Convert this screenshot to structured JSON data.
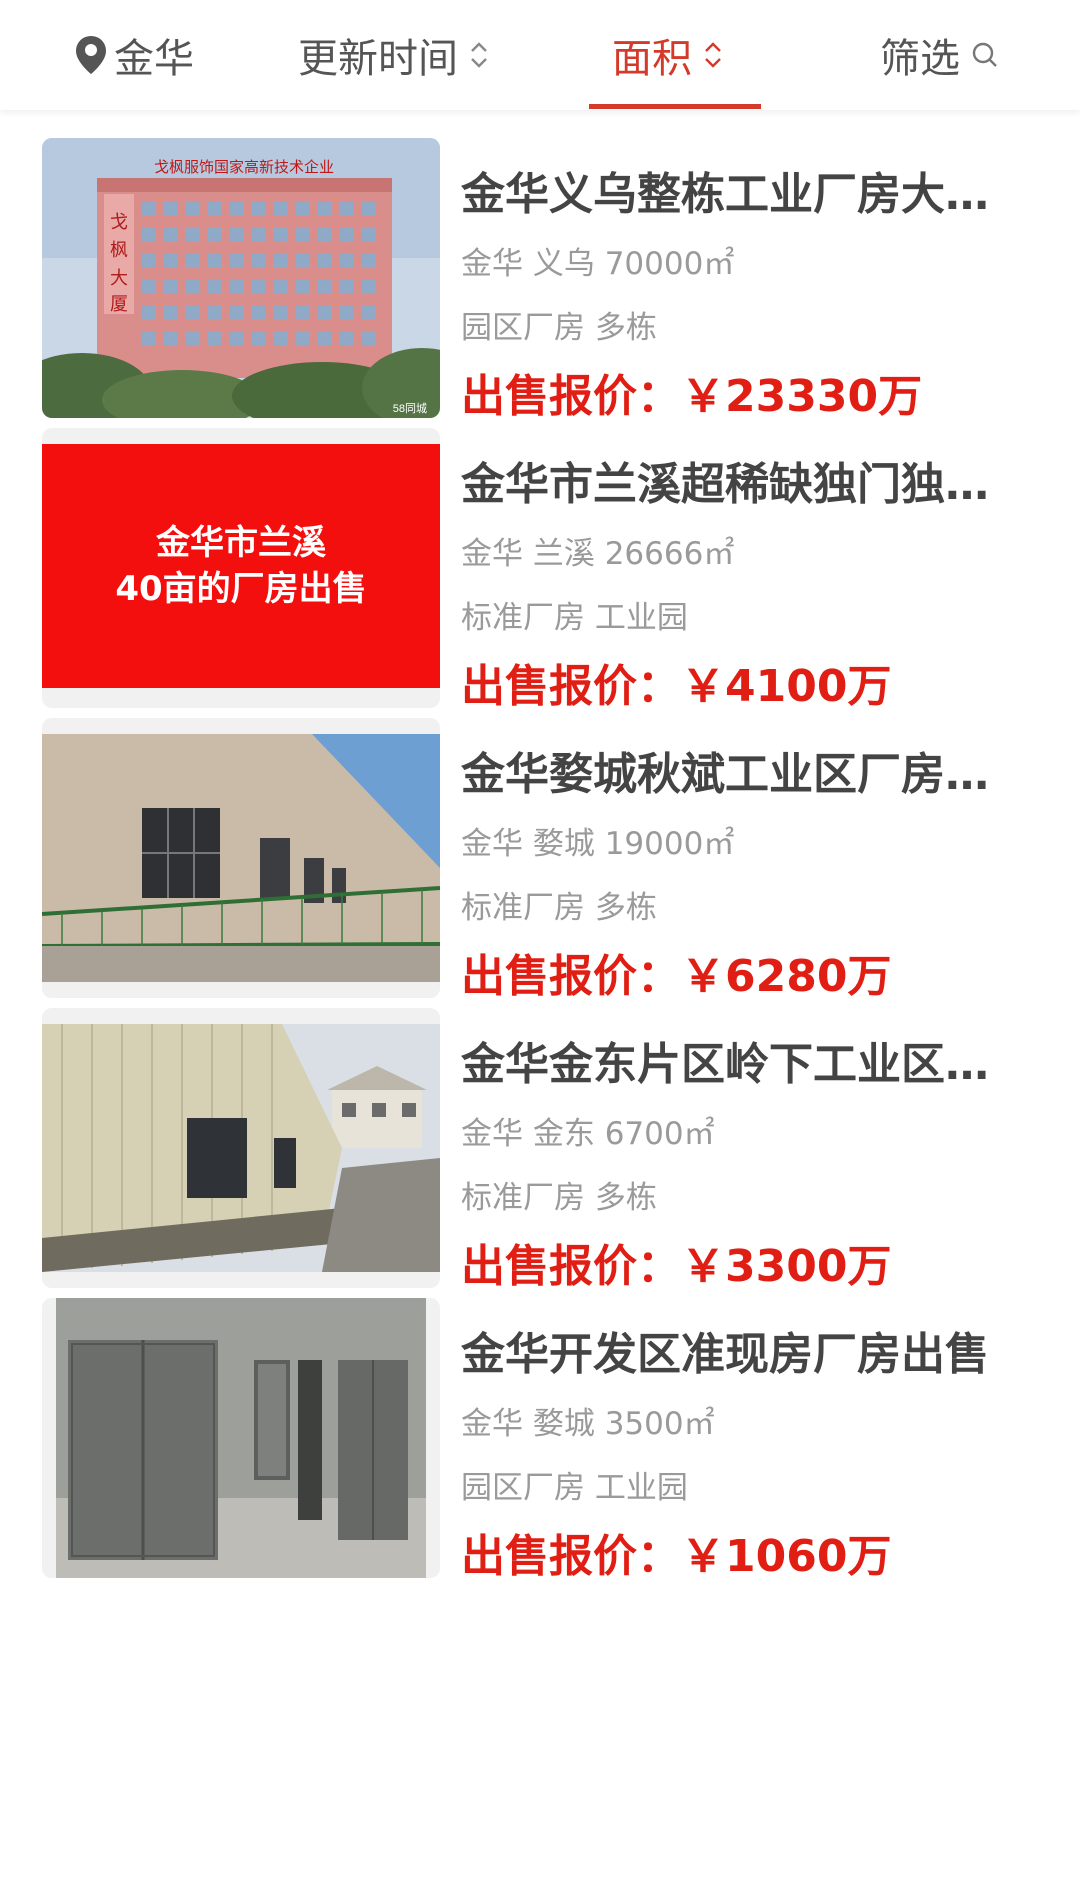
{
  "filter_bar": {
    "location": "金华",
    "update_time": "更新时间",
    "area": "面积",
    "filter": "筛选",
    "active_color": "#d43a2a"
  },
  "listings": [
    {
      "title": "金华义乌整栋工业厂房大…",
      "meta": "金华 义乌 70000㎡",
      "tags": "园区厂房 多栋",
      "price": "出售报价：￥23330万",
      "image": {
        "kind": "photo-office-building",
        "sign": "戈枫服饰国家高新技术企业",
        "side_sign": "戈枫大厦",
        "logo": "gefeng",
        "watermark": "58同城"
      }
    },
    {
      "title": "金华市兰溪超稀缺独门独…",
      "meta": "金华 兰溪 26666㎡",
      "tags": "标准厂房 工业园",
      "price": "出售报价：￥4100万",
      "image": {
        "kind": "red-text-banner",
        "line1": "金华市兰溪",
        "line2": "40亩的厂房出售"
      }
    },
    {
      "title": "金华婺城秋斌工业区厂房…",
      "meta": "金华 婺城 19000㎡",
      "tags": "标准厂房 多栋",
      "price": "出售报价：￥6280万",
      "image": {
        "kind": "photo-factory-wall-fence"
      }
    },
    {
      "title": "金华金东片区岭下工业区…",
      "meta": "金华 金东 6700㎡",
      "tags": "标准厂房 多栋",
      "price": "出售报价：￥3300万",
      "image": {
        "kind": "photo-metal-shed"
      }
    },
    {
      "title": "金华开发区准现房厂房出售",
      "meta": "金华 婺城 3500㎡",
      "tags": "园区厂房 工业园",
      "price": "出售报价：￥1060万",
      "image": {
        "kind": "photo-concrete-doors"
      }
    }
  ]
}
